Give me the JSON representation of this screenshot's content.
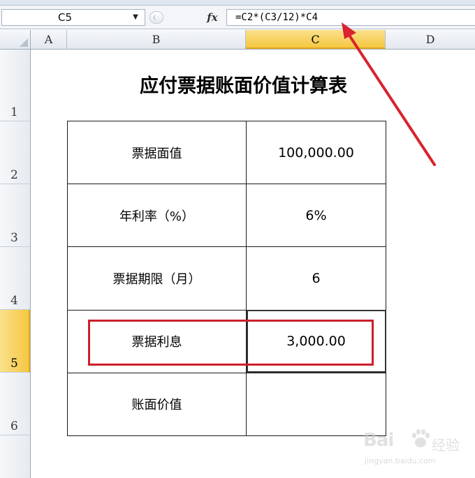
{
  "formula_bar": {
    "name_box": "C5",
    "fx_label": "fx",
    "formula": "=C2*(C3/12)*C4"
  },
  "columns": [
    "A",
    "B",
    "C",
    "D"
  ],
  "rows": [
    "1",
    "2",
    "3",
    "4",
    "5",
    "6"
  ],
  "active_cell": {
    "column": "C",
    "row": "5"
  },
  "sheet": {
    "title": "应付票据账面价值计算表",
    "table": [
      {
        "label": "票据面值",
        "value": "100,000.00"
      },
      {
        "label": "年利率（%）",
        "value": "6%"
      },
      {
        "label": "票据期限（月）",
        "value": "6"
      },
      {
        "label": "票据利息",
        "value": "3,000.00"
      },
      {
        "label": "账面价值",
        "value": ""
      }
    ]
  },
  "annotation": {
    "highlight_color": "#cc1f2a",
    "arrow_color": "#d9232e"
  },
  "watermark": {
    "logo": "Bai",
    "label": "经验",
    "url": "jingyan.baidu.com"
  },
  "colors": {
    "header_active": "#f5c842",
    "grid_border": "#1a1a1a"
  }
}
